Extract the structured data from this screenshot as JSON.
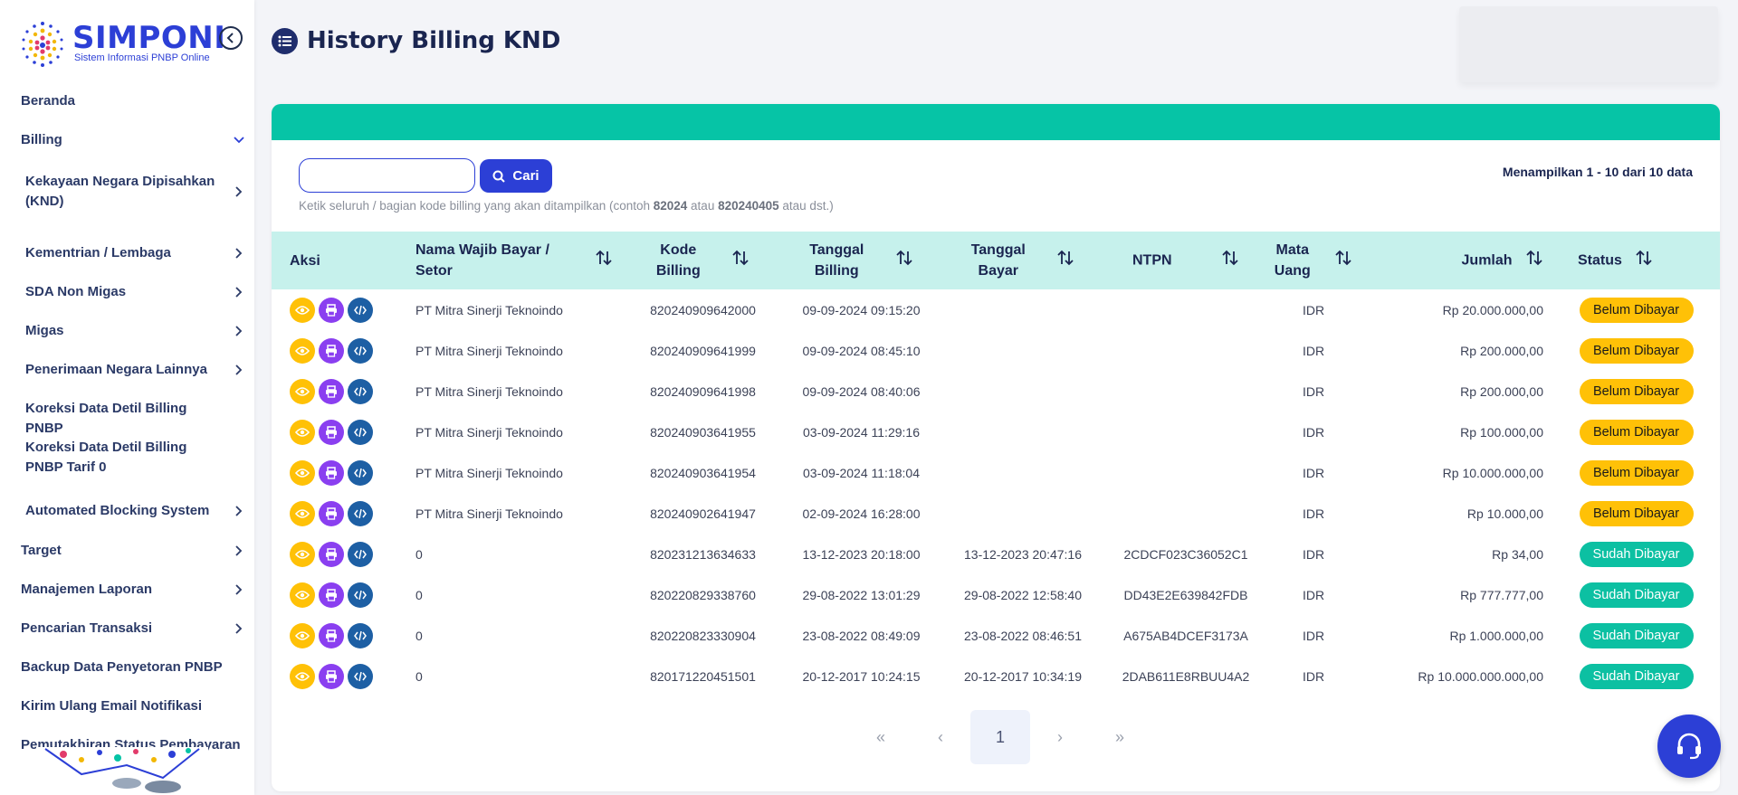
{
  "app": {
    "name": "SIMPONI",
    "subtitle": "Sistem Informasi PNBP Online"
  },
  "sidebar": {
    "items": [
      {
        "label": "Beranda",
        "level": "top",
        "chevron": false
      },
      {
        "label": "Billing",
        "level": "top",
        "chevron": "down"
      },
      {
        "label": "Kekayaan Negara Dipisahkan (KND)",
        "level": "sub",
        "chevron": "right"
      },
      {
        "label": "Kementrian / Lembaga",
        "level": "sub",
        "chevron": "right"
      },
      {
        "label": "SDA Non Migas",
        "level": "sub",
        "chevron": "right"
      },
      {
        "label": "Migas",
        "level": "sub",
        "chevron": "right"
      },
      {
        "label": "Penerimaan Negara Lainnya",
        "level": "sub",
        "chevron": "right"
      },
      {
        "label": "Koreksi Data Detil Billing PNBP",
        "level": "sub",
        "chevron": false
      },
      {
        "label": "Koreksi Data Detil Billing PNBP Tarif 0",
        "level": "sub",
        "chevron": false
      },
      {
        "label": "Automated Blocking System",
        "level": "sub",
        "chevron": "right"
      },
      {
        "label": "Target",
        "level": "top",
        "chevron": "right"
      },
      {
        "label": "Manajemen Laporan",
        "level": "top",
        "chevron": "right"
      },
      {
        "label": "Pencarian Transaksi",
        "level": "top",
        "chevron": "right"
      },
      {
        "label": "Backup Data Penyetoran PNBP",
        "level": "top",
        "chevron": false
      },
      {
        "label": "Kirim Ulang Email Notifikasi",
        "level": "top",
        "chevron": false
      },
      {
        "label": "Pemutakhiran Status Pembayaran",
        "level": "top",
        "chevron": false
      }
    ]
  },
  "header": {
    "title": "History Billing KND"
  },
  "search": {
    "value": "",
    "button_label": "Cari",
    "hint_prefix": "Ketik seluruh / bagian kode billing yang akan ditampilkan (contoh ",
    "hint_ex1": "82024",
    "hint_mid": " atau ",
    "hint_ex2": "820240405",
    "hint_suffix": " atau dst.)",
    "count_label": "Menampilkan 1 - 10 dari 10 data"
  },
  "table": {
    "columns": {
      "aksi": "Aksi",
      "nama_1": "Nama Wajib Bayar /",
      "nama_2": "Setor",
      "kode_1": "Kode",
      "kode_2": "Billing",
      "tgl_1": "Tanggal",
      "tgl_2": "Billing",
      "bayar_1": "Tanggal",
      "bayar_2": "Bayar",
      "ntpn": "NTPN",
      "mata_1": "Mata",
      "mata_2": "Uang",
      "jumlah": "Jumlah",
      "status": "Status"
    },
    "rows": [
      {
        "nama": "PT Mitra Sinerji Teknoindo",
        "kode": "820240909642000",
        "tgl_billing": "09-09-2024 09:15:20",
        "tgl_bayar": "",
        "ntpn": "",
        "mata_uang": "IDR",
        "jumlah": "Rp 20.000.000,00",
        "status": "Belum Dibayar",
        "paid": false
      },
      {
        "nama": "PT Mitra Sinerji Teknoindo",
        "kode": "820240909641999",
        "tgl_billing": "09-09-2024 08:45:10",
        "tgl_bayar": "",
        "ntpn": "",
        "mata_uang": "IDR",
        "jumlah": "Rp 200.000,00",
        "status": "Belum Dibayar",
        "paid": false
      },
      {
        "nama": "PT Mitra Sinerji Teknoindo",
        "kode": "820240909641998",
        "tgl_billing": "09-09-2024 08:40:06",
        "tgl_bayar": "",
        "ntpn": "",
        "mata_uang": "IDR",
        "jumlah": "Rp 200.000,00",
        "status": "Belum Dibayar",
        "paid": false
      },
      {
        "nama": "PT Mitra Sinerji Teknoindo",
        "kode": "820240903641955",
        "tgl_billing": "03-09-2024 11:29:16",
        "tgl_bayar": "",
        "ntpn": "",
        "mata_uang": "IDR",
        "jumlah": "Rp 100.000,00",
        "status": "Belum Dibayar",
        "paid": false
      },
      {
        "nama": "PT Mitra Sinerji Teknoindo",
        "kode": "820240903641954",
        "tgl_billing": "03-09-2024 11:18:04",
        "tgl_bayar": "",
        "ntpn": "",
        "mata_uang": "IDR",
        "jumlah": "Rp 10.000.000,00",
        "status": "Belum Dibayar",
        "paid": false
      },
      {
        "nama": "PT Mitra Sinerji Teknoindo",
        "kode": "820240902641947",
        "tgl_billing": "02-09-2024 16:28:00",
        "tgl_bayar": "",
        "ntpn": "",
        "mata_uang": "IDR",
        "jumlah": "Rp 10.000,00",
        "status": "Belum Dibayar",
        "paid": false
      },
      {
        "nama": "0",
        "kode": "820231213634633",
        "tgl_billing": "13-12-2023 20:18:00",
        "tgl_bayar": "13-12-2023 20:47:16",
        "ntpn": "2CDCF023C36052C1",
        "mata_uang": "IDR",
        "jumlah": "Rp 34,00",
        "status": "Sudah Dibayar",
        "paid": true
      },
      {
        "nama": "0",
        "kode": "820220829338760",
        "tgl_billing": "29-08-2022 13:01:29",
        "tgl_bayar": "29-08-2022 12:58:40",
        "ntpn": "DD43E2E639842FDB",
        "mata_uang": "IDR",
        "jumlah": "Rp 777.777,00",
        "status": "Sudah Dibayar",
        "paid": true
      },
      {
        "nama": "0",
        "kode": "820220823330904",
        "tgl_billing": "23-08-2022 08:49:09",
        "tgl_bayar": "23-08-2022 08:46:51",
        "ntpn": "A675AB4DCEF3173A",
        "mata_uang": "IDR",
        "jumlah": "Rp 1.000.000,00",
        "status": "Sudah Dibayar",
        "paid": true
      },
      {
        "nama": "0",
        "kode": "820171220451501",
        "tgl_billing": "20-12-2017 10:24:15",
        "tgl_bayar": "20-12-2017 10:34:19",
        "ntpn": "2DAB611E8RBUU4A2",
        "mata_uang": "IDR",
        "jumlah": "Rp 10.000.000.000,00",
        "status": "Sudah Dibayar",
        "paid": true
      }
    ]
  },
  "pagination": {
    "first": "«",
    "prev": "‹",
    "current": "1",
    "next": "›",
    "last": "»"
  },
  "colors": {
    "primary": "#2c3fd6",
    "teal": "#06c4a6",
    "header_bg": "#c6f1ec",
    "unpaid": "#ffc107",
    "paid": "#0cc0a2",
    "print": "#8a3ff0",
    "code": "#1d5fa4"
  }
}
